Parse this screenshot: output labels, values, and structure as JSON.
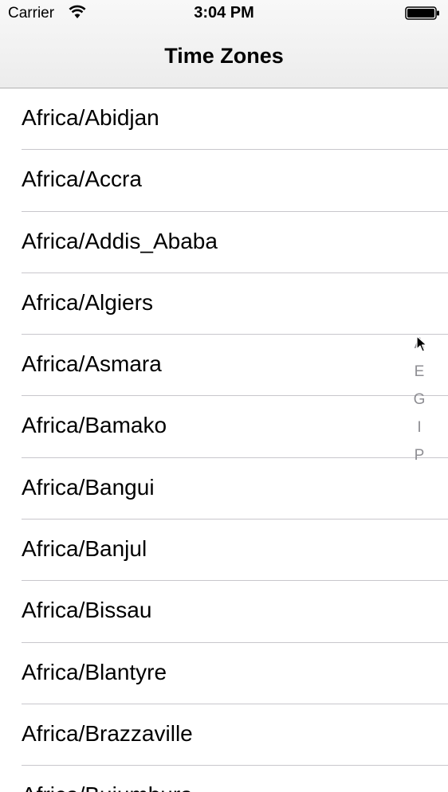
{
  "status_bar": {
    "carrier": "Carrier",
    "time": "3:04 PM",
    "wifi_icon": "wifi-icon",
    "battery_icon": "battery-icon"
  },
  "nav": {
    "title": "Time Zones"
  },
  "table": {
    "rows": [
      "Africa/Abidjan",
      "Africa/Accra",
      "Africa/Addis_Ababa",
      "Africa/Algiers",
      "Africa/Asmara",
      "Africa/Bamako",
      "Africa/Bangui",
      "Africa/Banjul",
      "Africa/Bissau",
      "Africa/Blantyre",
      "Africa/Brazzaville",
      "Africa/Bujumbura"
    ]
  },
  "section_index": {
    "letters": [
      "A",
      "E",
      "G",
      "I",
      "P"
    ]
  },
  "colors": {
    "separator": "#c8c7cc",
    "index_text": "#8e8e93",
    "navbar_background": "#f2f2f2"
  }
}
